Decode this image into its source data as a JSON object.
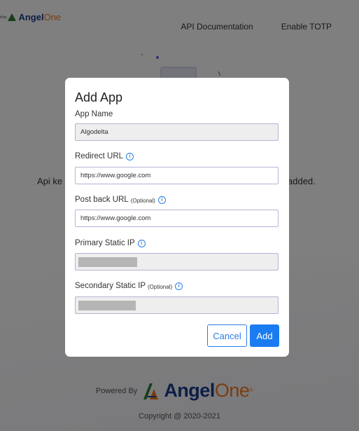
{
  "header": {
    "powered_prefix": "d by",
    "logo_angel": "Angel",
    "logo_one": "One",
    "nav": [
      "API Documentation",
      "Enable TOTP"
    ]
  },
  "background": {
    "empty_message_left": "Api ke",
    "empty_message_right": "added."
  },
  "footer": {
    "powered_label": "Powered By",
    "brand_angel": "Angel",
    "brand_one": "One",
    "copyright": "Copyright @ 2020-2021"
  },
  "modal": {
    "title": "Add App",
    "fields": {
      "app_name": {
        "label": "App Name",
        "value": "Algodelta"
      },
      "redirect_url": {
        "label": "Redirect URL",
        "value": "https://www.google.com"
      },
      "post_back_url": {
        "label": "Post back URL",
        "optional": "(Optional)",
        "value": "https://www.google.com"
      },
      "primary_ip": {
        "label": "Primary Static IP",
        "masked": true
      },
      "secondary_ip": {
        "label": "Secondary Static IP",
        "optional": "(Optional)",
        "masked": true
      }
    },
    "info_icon_glyph": "i",
    "cancel_label": "Cancel",
    "add_label": "Add"
  },
  "colors": {
    "accent": "#1a7cf0",
    "brand_blue": "#1b3c8c",
    "brand_orange": "#f47920",
    "input_border": "#b7b3d8"
  }
}
